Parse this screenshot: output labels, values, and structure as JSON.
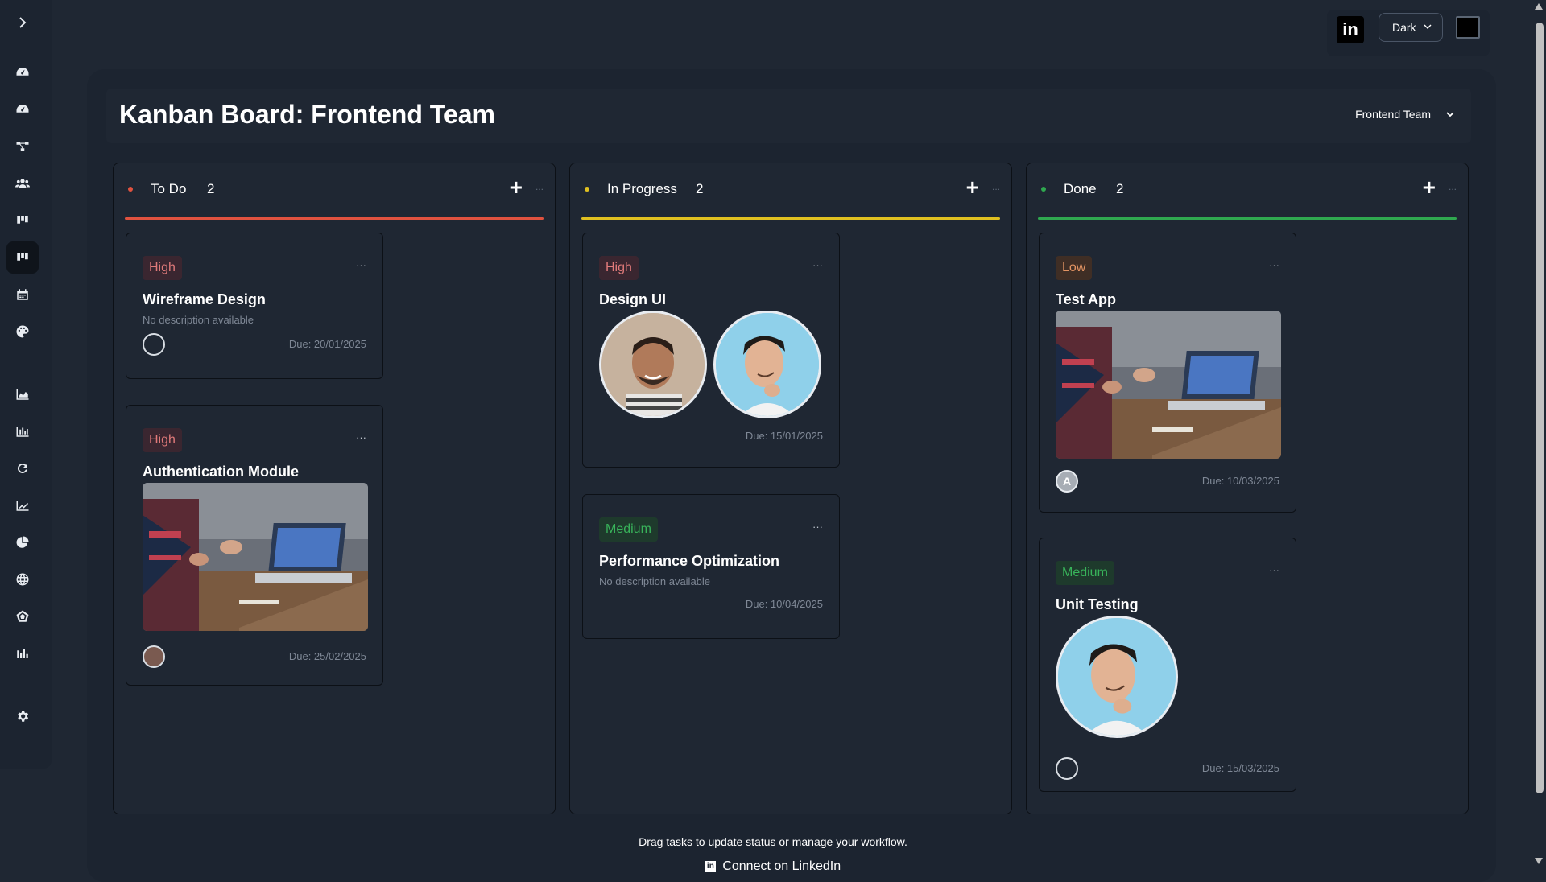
{
  "sidebar": {
    "items": [
      {
        "icon": "chevron-right-icon"
      },
      {
        "icon": "dashboard-gauge-icon"
      },
      {
        "icon": "dashboard-gauge-icon"
      },
      {
        "icon": "workflow-icon"
      },
      {
        "icon": "users-icon"
      },
      {
        "icon": "kanban-icon"
      },
      {
        "icon": "kanban-icon",
        "active": true
      },
      {
        "icon": "calendar-icon"
      },
      {
        "icon": "palette-icon"
      },
      {
        "icon": "area-chart-icon"
      },
      {
        "icon": "bar-chart-icon"
      },
      {
        "icon": "refresh-icon"
      },
      {
        "icon": "line-chart-icon"
      },
      {
        "icon": "pie-chart-icon"
      },
      {
        "icon": "globe-icon"
      },
      {
        "icon": "radar-chart-icon"
      },
      {
        "icon": "column-chart-icon"
      },
      {
        "icon": "settings-gear-icon"
      }
    ]
  },
  "topbar": {
    "linkedin_icon": "linkedin-icon",
    "theme_value": "Dark",
    "color_swatch": "#000000"
  },
  "header": {
    "title": "Kanban Board: Frontend Team",
    "team_select": "Frontend Team"
  },
  "columns": [
    {
      "title": "To Do",
      "count": "2",
      "color": "#e0523f",
      "cards": [
        {
          "priority": "High",
          "title": "Wireframe Design",
          "description": "No description available",
          "due": "Due: 20/01/2025",
          "more": "···"
        },
        {
          "priority": "High",
          "title": "Authentication Module",
          "due": "Due: 25/02/2025",
          "more": "···"
        }
      ]
    },
    {
      "title": "In Progress",
      "count": "2",
      "color": "#e0c020",
      "cards": [
        {
          "priority": "High",
          "title": "Design UI",
          "due": "Due: 15/01/2025",
          "more": "···"
        },
        {
          "priority": "Medium",
          "title": "Performance Optimization",
          "description": "No description available",
          "due": "Due: 10/04/2025",
          "more": "···"
        }
      ]
    },
    {
      "title": "Done",
      "count": "2",
      "color": "#2fa84f",
      "cards": [
        {
          "priority": "Low",
          "title": "Test App",
          "due": "Due: 10/03/2025",
          "avatar_letter": "A",
          "more": "···"
        },
        {
          "priority": "Medium",
          "title": "Unit Testing",
          "due": "Due: 15/03/2025",
          "more": "···"
        }
      ]
    }
  ],
  "column_add": "+",
  "column_more": "...",
  "footer": {
    "hint": "Drag tasks to update status or manage your workflow.",
    "link": "Connect on LinkedIn"
  }
}
